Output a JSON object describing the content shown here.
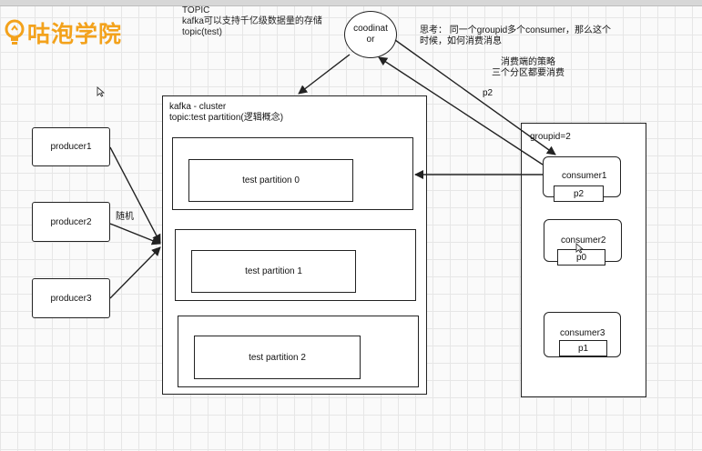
{
  "logo": {
    "text": "咕泡学院",
    "icon": "lightbulb-icon",
    "color": "#f3a21c"
  },
  "notes": {
    "topic": "TOPIC\nkafka可以支持千亿级数据量的存储\ntopic(test)",
    "question": "思考： 同一个groupid多个consumer，那么这个\n时候，如何消费消息",
    "strategy": "消费端的策略\n三个分区都要消费"
  },
  "producers": [
    {
      "label": "producer1"
    },
    {
      "label": "producer2"
    },
    {
      "label": "producer3"
    }
  ],
  "random_label": "随机",
  "cluster": {
    "title": "kafka - cluster\ntopic:test partition(逻辑概念)",
    "partitions": [
      {
        "label": "test partition 0"
      },
      {
        "label": "test partition 1"
      },
      {
        "label": "test partition 2"
      }
    ]
  },
  "coordinator": {
    "label": "coodinat\nor"
  },
  "arrow_label_p2": "p2",
  "group": {
    "label": "groupid=2",
    "consumers": [
      {
        "name": "consumer1",
        "partition": "p2"
      },
      {
        "name": "consumer2",
        "partition": "p0"
      },
      {
        "name": "consumer3",
        "partition": "p1"
      }
    ]
  },
  "cursor": {
    "icon": "mouse-pointer-icon"
  }
}
